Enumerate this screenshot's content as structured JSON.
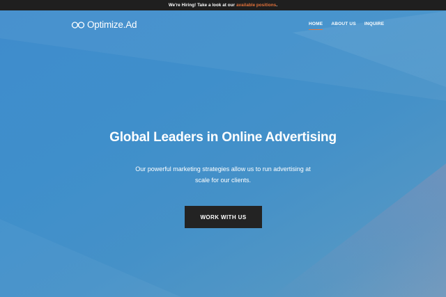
{
  "announcement": {
    "text": "We're Hiring! Take a look at our",
    "link_text": "available positions",
    "trailing": ".",
    "link_color": "#e8743b"
  },
  "brand": {
    "name": "Optimize.Ad",
    "logo_icon": "infinity-logo-icon"
  },
  "nav": {
    "items": [
      {
        "label": "HOME",
        "active": true
      },
      {
        "label": "ABOUT US",
        "active": false
      },
      {
        "label": "INQUIRE",
        "active": false
      }
    ],
    "active_underline_color": "#e8743b"
  },
  "hero": {
    "headline": "Global Leaders in Online Advertising",
    "subtext": "Our powerful marketing strategies allow us to run advertising at scale for our clients.",
    "cta_label": "WORK WITH US",
    "background_color": "#3f8fca",
    "cta_color": "#232323"
  }
}
